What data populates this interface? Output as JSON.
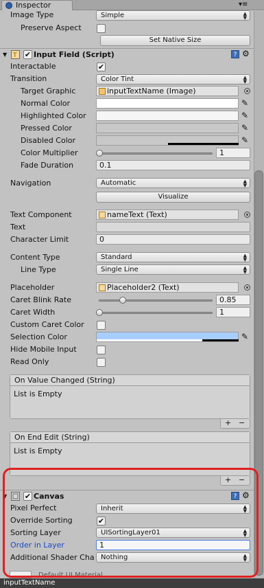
{
  "tab": {
    "title": "Inspector"
  },
  "image": {
    "image_type_label": "Image Type",
    "image_type_value": "Simple",
    "preserve_aspect_label": "Preserve Aspect",
    "set_native_size_button": "Set Native Size"
  },
  "input_field": {
    "title": "Input Field (Script)",
    "interactable_label": "Interactable",
    "transition_label": "Transition",
    "transition_value": "Color Tint",
    "target_graphic_label": "Target Graphic",
    "target_graphic_value": "inputTextName (Image)",
    "normal_color_label": "Normal Color",
    "highlighted_color_label": "Highlighted Color",
    "pressed_color_label": "Pressed Color",
    "disabled_color_label": "Disabled Color",
    "color_multiplier_label": "Color Multiplier",
    "color_multiplier_value": "1",
    "fade_duration_label": "Fade Duration",
    "fade_duration_value": "0.1",
    "navigation_label": "Navigation",
    "navigation_value": "Automatic",
    "visualize_button": "Visualize",
    "text_component_label": "Text Component",
    "text_component_value": "nameText (Text)",
    "text_label": "Text",
    "character_limit_label": "Character Limit",
    "character_limit_value": "0",
    "content_type_label": "Content Type",
    "content_type_value": "Standard",
    "line_type_label": "Line Type",
    "line_type_value": "Single Line",
    "placeholder_label": "Placeholder",
    "placeholder_value": "Placeholder2 (Text)",
    "caret_blink_rate_label": "Caret Blink Rate",
    "caret_blink_rate_value": "0.85",
    "caret_width_label": "Caret Width",
    "caret_width_value": "1",
    "custom_caret_color_label": "Custom Caret Color",
    "selection_color_label": "Selection Color",
    "hide_mobile_input_label": "Hide Mobile Input",
    "read_only_label": "Read Only",
    "on_value_changed_title": "On Value Changed (String)",
    "on_value_changed_body": "List is Empty",
    "on_end_edit_title": "On End Edit (String)",
    "on_end_edit_body": "List is Empty",
    "plus": "+",
    "minus": "−"
  },
  "canvas": {
    "title": "Canvas",
    "pixel_perfect_label": "Pixel Perfect",
    "pixel_perfect_value": "Inherit",
    "override_sorting_label": "Override Sorting",
    "sorting_layer_label": "Sorting Layer",
    "sorting_layer_value": "UISortingLayer01",
    "order_in_layer_label": "Order in Layer",
    "order_in_layer_value": "1",
    "additional_shader_label": "Additional Shader Cha",
    "additional_shader_value": "Nothing"
  },
  "footer": {
    "partial_text": "Default UI Material",
    "bottom_label": "inputTextName"
  },
  "colors": {
    "normal": "#ffffff",
    "highlighted": "#f5f5f5",
    "pressed": "#c8c8c8",
    "disabled": "#c8c8c8",
    "selection": "#a8cefe",
    "accent": "#e02020"
  },
  "checks": {
    "preserve_aspect": false,
    "interactable": true,
    "custom_caret_color": false,
    "hide_mobile_input": false,
    "read_only": false,
    "override_sorting": true,
    "input_field_enabled": true,
    "canvas_enabled": true
  },
  "sliders": {
    "color_multiplier": 0.0,
    "caret_blink_rate": 0.21,
    "caret_width": 0.0
  }
}
